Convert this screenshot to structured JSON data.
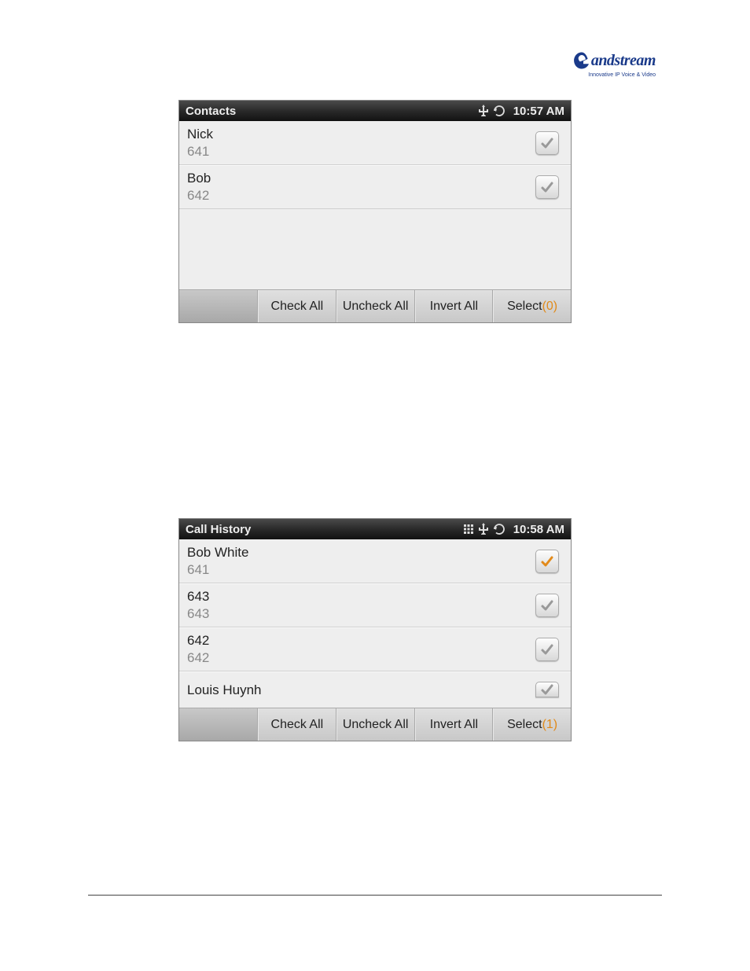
{
  "logo": {
    "brand": "andstream",
    "tagline": "Innovative IP Voice & Video"
  },
  "screen1": {
    "title": "Contacts",
    "status": {
      "icons": [
        "usb-icon",
        "refresh-icon"
      ],
      "time": "10:57 AM"
    },
    "items": [
      {
        "name": "Nick",
        "number": "641",
        "checked": false
      },
      {
        "name": "Bob",
        "number": "642",
        "checked": false
      }
    ],
    "toolbar": {
      "check_all": "Check All",
      "uncheck_all": "Uncheck All",
      "invert_all": "Invert All",
      "select_label": "Select",
      "select_count": "(0)"
    }
  },
  "screen2": {
    "title": "Call History",
    "status": {
      "icons": [
        "dialpad-icon",
        "usb-icon",
        "refresh-icon"
      ],
      "time": "10:58 AM"
    },
    "items": [
      {
        "name": "Bob White",
        "number": "641",
        "checked": true
      },
      {
        "name": "643",
        "number": "643",
        "checked": false
      },
      {
        "name": "642",
        "number": "642",
        "checked": false
      },
      {
        "name": "Louis Huynh",
        "number": "",
        "checked": false,
        "partial": true
      }
    ],
    "toolbar": {
      "check_all": "Check All",
      "uncheck_all": "Uncheck All",
      "invert_all": "Invert All",
      "select_label": "Select",
      "select_count": "(1)"
    }
  }
}
